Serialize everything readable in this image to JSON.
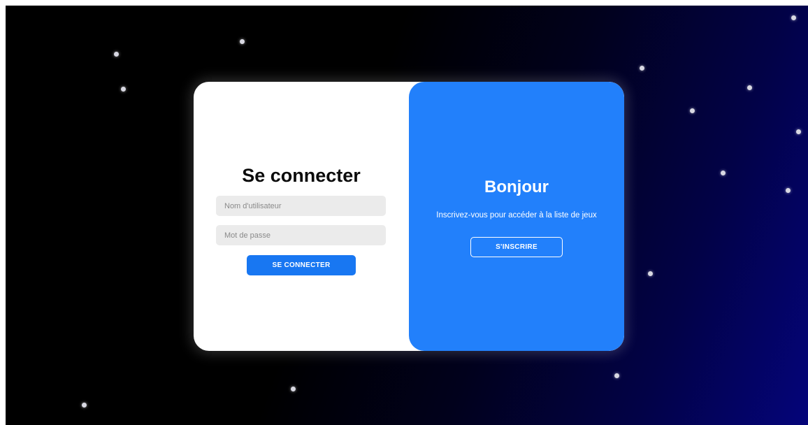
{
  "login": {
    "title": "Se connecter",
    "username_placeholder": "Nom d'utilisateur",
    "password_placeholder": "Mot de passe",
    "submit_label": "SE CONNECTER"
  },
  "signup": {
    "title": "Bonjour",
    "message": "Inscrivez-vous pour accéder à la liste de jeux",
    "button_label": "S'INSCRIRE"
  },
  "colors": {
    "accent": "#2280fb",
    "button": "#1877f2",
    "field_bg": "#ebebeb",
    "background_dark": "#000000",
    "background_blue": "#04047a"
  }
}
